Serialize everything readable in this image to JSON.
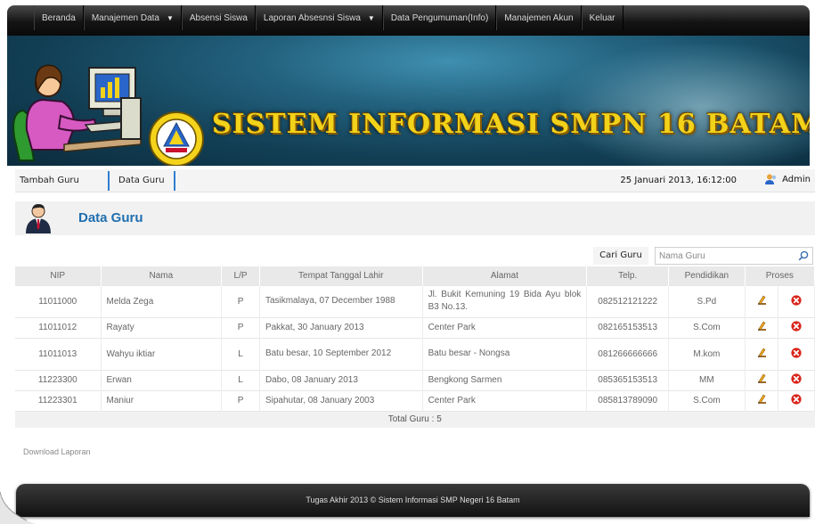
{
  "nav": {
    "items": [
      {
        "label": "Beranda",
        "dropdown": false
      },
      {
        "label": "Manajemen Data",
        "dropdown": true
      },
      {
        "label": "Absensi Siswa",
        "dropdown": false
      },
      {
        "label": "Laporan Absesnsi Siswa",
        "dropdown": true
      },
      {
        "label": "Data Pengumuman(Info)",
        "dropdown": false
      },
      {
        "label": "Manajemen Akun",
        "dropdown": false
      },
      {
        "label": "Keluar",
        "dropdown": false
      }
    ]
  },
  "banner": {
    "title": "SISTEM INFORMASI SMPN 16 BATAM"
  },
  "subnav": {
    "tab_tambah": "Tambah Guru",
    "tab_data": "Data Guru",
    "datetime": "25 Januari 2013, 16:12:00",
    "user": "Admin"
  },
  "page": {
    "heading": "Data Guru"
  },
  "search": {
    "label": "Cari Guru",
    "placeholder": "Nama Guru"
  },
  "table": {
    "headers": [
      "NIP",
      "Nama",
      "L/P",
      "Tempat Tanggal Lahir",
      "Alamat",
      "Telp.",
      "Pendidikan",
      "Proses"
    ],
    "rows": [
      {
        "nip": "11011000",
        "nama": "Melda Zega",
        "lp": "P",
        "ttl": "Tasikmalaya, 07 December 1988",
        "alamat": "Jl. Bukit Kemuning 19 Bida Ayu blok B3 No.13.",
        "telp": "082512121222",
        "pendidikan": "S.Pd"
      },
      {
        "nip": "11011012",
        "nama": "Rayaty",
        "lp": "P",
        "ttl": "Pakkat, 30 January 2013",
        "alamat": "Center Park",
        "telp": "082165153513",
        "pendidikan": "S.Com"
      },
      {
        "nip": "11011013",
        "nama": "Wahyu iktiar",
        "lp": "L",
        "ttl": "Batu besar, 10 September 2012",
        "alamat": "Batu besar - Nongsa",
        "telp": "081266666666",
        "pendidikan": "M.kom"
      },
      {
        "nip": "11223300",
        "nama": "Erwan",
        "lp": "L",
        "ttl": "Dabo, 08 January 2013",
        "alamat": "Bengkong Sarmen",
        "telp": "085365153513",
        "pendidikan": "MM"
      },
      {
        "nip": "11223301",
        "nama": "Maniur",
        "lp": "P",
        "ttl": "Sipahutar, 08 January 2003",
        "alamat": "Center Park",
        "telp": "085813789090",
        "pendidikan": "S.Com"
      }
    ],
    "total": "Total Guru : 5"
  },
  "download_label": "Download Laporan",
  "footer": {
    "text": "Tugas Akhir 2013 © Sistem Informasi SMP Negeri 16 Batam"
  },
  "colors": {
    "accent": "#1f6fb0",
    "banner_title": "#f2d21a",
    "delete": "#d9261c"
  }
}
